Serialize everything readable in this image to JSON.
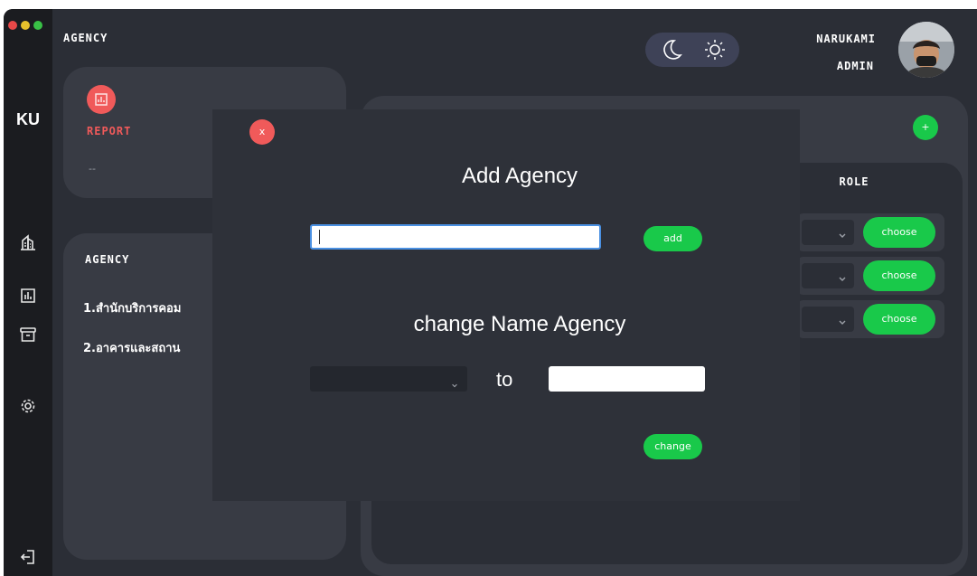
{
  "app": {
    "brand": "KU",
    "page_title": "AGENCY"
  },
  "user": {
    "name": "NARUKAMI",
    "role": "ADMIN"
  },
  "theme_toggle": {
    "options": [
      "moon-icon",
      "sun-icon"
    ]
  },
  "report_card": {
    "label": "REPORT",
    "value": "--",
    "icon": "report-chart-icon"
  },
  "agency_card": {
    "heading": "AGENCY",
    "items": [
      "1.สำนักบริการคอม",
      "2.อาคารและสถาน"
    ]
  },
  "user_table": {
    "role_header": "ROLE",
    "add_button_label": "+",
    "rows": [
      {
        "choose_label": "choose"
      },
      {
        "choose_label": "choose"
      },
      {
        "choose_label": "choose"
      }
    ]
  },
  "modal": {
    "close_label": "x",
    "title": "Add Agency",
    "add_input_value": "",
    "add_button_label": "add",
    "subtitle": "change Name Agency",
    "select_value": "",
    "to_label": "to",
    "new_name_value": "",
    "change_button_label": "change"
  },
  "colors": {
    "background": "#2b2e36",
    "sidebar": "#1b1c20",
    "card": "#383b44",
    "modal": "#2e3139",
    "accent_red": "#f05a5a",
    "accent_green": "#19c94a",
    "toggle": "#3e4257"
  }
}
